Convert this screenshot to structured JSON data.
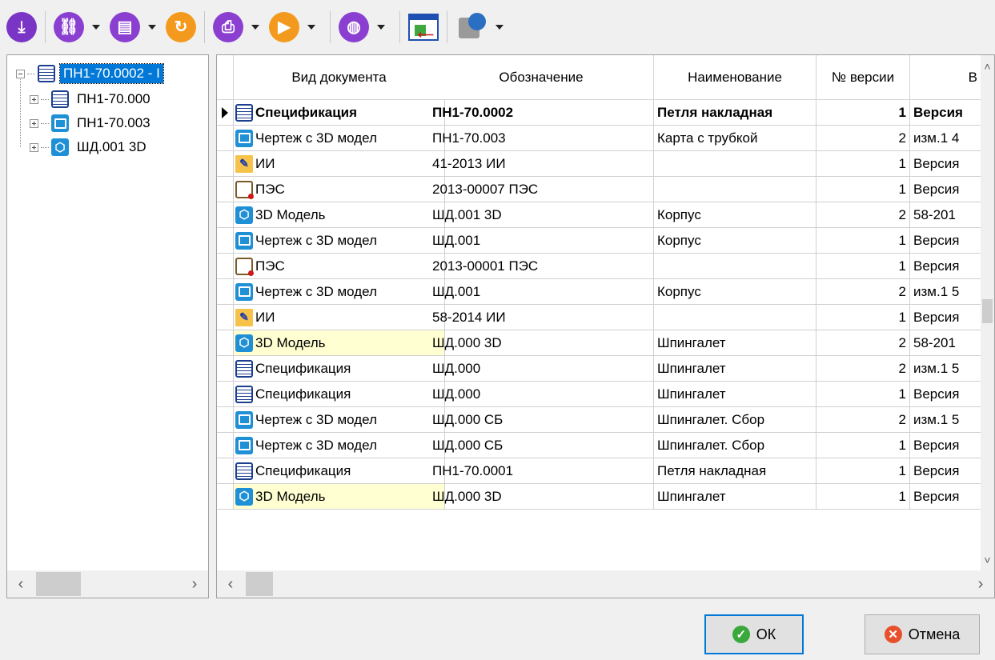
{
  "toolbar": {
    "buttons": [
      {
        "name": "download",
        "icon": "download-icon",
        "color": "#7b35c6",
        "dropdown": false
      },
      {
        "name": "link",
        "icon": "link-icon",
        "color": "#8a3fd1",
        "dropdown": true
      },
      {
        "name": "document",
        "icon": "document-icon",
        "color": "#8a3fd1",
        "dropdown": true
      },
      {
        "name": "refresh",
        "icon": "refresh-icon",
        "color": "#f39a1e",
        "dropdown": false
      },
      {
        "name": "print",
        "icon": "printer-icon",
        "color": "#8a3fd1",
        "dropdown": true
      },
      {
        "name": "play",
        "icon": "play-icon",
        "color": "#f39a1e",
        "dropdown": true
      },
      {
        "name": "globe",
        "icon": "globe-icon",
        "color": "#8a3fd1",
        "dropdown": true
      },
      {
        "name": "import",
        "icon": "import-window-icon",
        "color": "#1f4fb0",
        "dropdown": false
      },
      {
        "name": "export",
        "icon": "export-box-icon",
        "color": "#2b6fc2",
        "dropdown": true
      }
    ]
  },
  "tree": {
    "root": {
      "label": "ПН1-70.0002 - I",
      "icon": "spec"
    },
    "children": [
      {
        "label": "ПН1-70.000",
        "icon": "spec"
      },
      {
        "label": "ПН1-70.003",
        "icon": "draw"
      },
      {
        "label": "ШД.001 3D",
        "icon": "3d"
      }
    ]
  },
  "grid": {
    "columns": [
      "Вид документа",
      "Обозначение",
      "Наименование",
      "№ версии",
      "В"
    ],
    "rows": [
      {
        "icon": "spec",
        "type": "Спецификация",
        "designation": "ПН1-70.0002",
        "name": "Петля накладная",
        "version": "1",
        "extra": "Версия",
        "current": true
      },
      {
        "icon": "draw",
        "type": "Чертеж с 3D модел",
        "designation": "ПН1-70.003",
        "name": "Карта с трубкой",
        "version": "2",
        "extra": "изм.1 4"
      },
      {
        "icon": "ii",
        "type": "ИИ",
        "designation": "41-2013 ИИ",
        "name": "",
        "version": "1",
        "extra": "Версия"
      },
      {
        "icon": "pes",
        "type": "ПЭС",
        "designation": "2013-00007 ПЭС",
        "name": "",
        "version": "1",
        "extra": "Версия"
      },
      {
        "icon": "3d",
        "type": "3D Модель",
        "designation": "ШД.001 3D",
        "name": "Корпус",
        "version": "2",
        "extra": "58-201"
      },
      {
        "icon": "draw",
        "type": "Чертеж с 3D модел",
        "designation": "ШД.001",
        "name": "Корпус",
        "version": "1",
        "extra": "Версия"
      },
      {
        "icon": "pes",
        "type": "ПЭС",
        "designation": "2013-00001 ПЭС",
        "name": "",
        "version": "1",
        "extra": "Версия"
      },
      {
        "icon": "draw",
        "type": "Чертеж с 3D модел",
        "designation": "ШД.001",
        "name": "Корпус",
        "version": "2",
        "extra": "изм.1 5"
      },
      {
        "icon": "ii",
        "type": "ИИ",
        "designation": "58-2014 ИИ",
        "name": "",
        "version": "1",
        "extra": "Версия"
      },
      {
        "icon": "3d",
        "type": "3D Модель",
        "designation": "ШД.000 3D",
        "name": "Шпингалет",
        "version": "2",
        "extra": "58-201",
        "highlight": true
      },
      {
        "icon": "spec",
        "type": "Спецификация",
        "designation": "ШД.000",
        "name": "Шпингалет",
        "version": "2",
        "extra": "изм.1 5"
      },
      {
        "icon": "spec",
        "type": "Спецификация",
        "designation": "ШД.000",
        "name": "Шпингалет",
        "version": "1",
        "extra": "Версия"
      },
      {
        "icon": "draw",
        "type": "Чертеж с 3D модел",
        "designation": "ШД.000 СБ",
        "name": "Шпингалет. Сбор",
        "version": "2",
        "extra": "изм.1 5"
      },
      {
        "icon": "draw",
        "type": "Чертеж с 3D модел",
        "designation": "ШД.000 СБ",
        "name": "Шпингалет. Сбор",
        "version": "1",
        "extra": "Версия"
      },
      {
        "icon": "spec",
        "type": "Спецификация",
        "designation": "ПН1-70.0001",
        "name": "Петля накладная",
        "version": "1",
        "extra": "Версия"
      },
      {
        "icon": "3d",
        "type": "3D Модель",
        "designation": "ШД.000 3D",
        "name": "Шпингалет",
        "version": "1",
        "extra": "Версия",
        "highlight": true
      }
    ]
  },
  "buttons": {
    "ok": "ОК",
    "cancel": "Отмена"
  },
  "colors": {
    "selection": "#0078d7",
    "highlight_cell": "#ffffd2",
    "ok_icon": "#3ba83b",
    "cancel_icon": "#e8502c"
  }
}
